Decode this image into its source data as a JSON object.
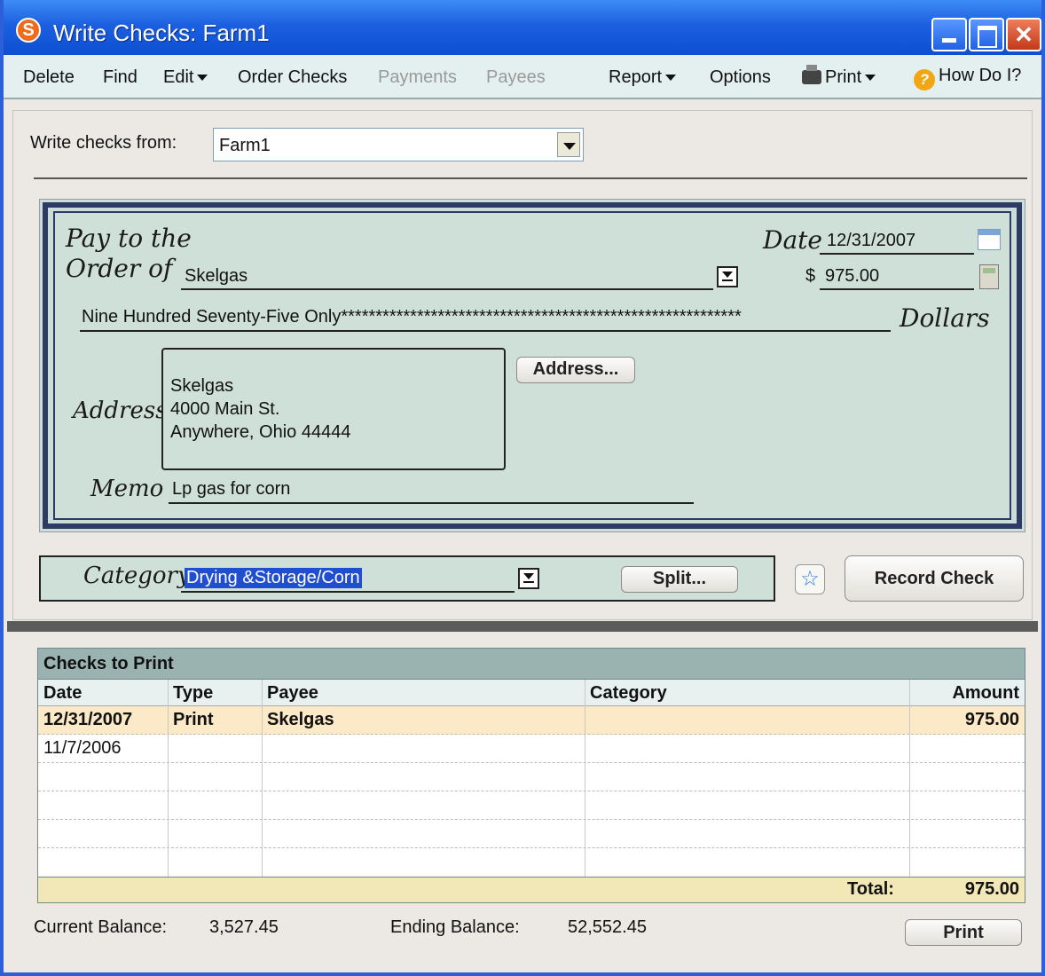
{
  "window": {
    "title": "Write Checks: Farm1",
    "close_glyph": "✕"
  },
  "menu": {
    "delete": "Delete",
    "find": "Find",
    "edit": "Edit",
    "order_checks": "Order Checks",
    "payments": "Payments",
    "payees": "Payees",
    "report": "Report",
    "options": "Options",
    "print": "Print",
    "how_do_i": "How Do I?"
  },
  "account": {
    "label": "Write checks from:",
    "value": "Farm1"
  },
  "check": {
    "pay_label_line1": "Pay to the",
    "pay_label_line2": "Order of",
    "payee": "Skelgas",
    "date_label": "Date",
    "date": "12/31/2007",
    "dollar_sign": "$",
    "amount": "975.00",
    "amount_words": "Nine Hundred Seventy-Five Only**********************************************************",
    "dollars_label": "Dollars",
    "address_label": "Address",
    "address_lines": [
      "Skelgas",
      "4000 Main St.",
      "Anywhere, Ohio 44444"
    ],
    "address_button": "Address...",
    "memo_label": "Memo",
    "memo": "Lp gas for corn"
  },
  "category": {
    "label": "Category",
    "value": "Drying &Storage/Corn",
    "split_button": "Split...",
    "record_button": "Record Check"
  },
  "checks_to_print": {
    "title": "Checks to Print",
    "columns": {
      "date": "Date",
      "type": "Type",
      "payee": "Payee",
      "category": "Category",
      "amount": "Amount"
    },
    "rows": [
      {
        "date": "12/31/2007",
        "type": "Print",
        "payee": "Skelgas",
        "category": "",
        "amount": "975.00"
      },
      {
        "date": "11/7/2006",
        "type": "",
        "payee": "",
        "category": "",
        "amount": ""
      }
    ],
    "total_label": "Total:",
    "total_value": "975.00"
  },
  "footer": {
    "current_balance_label": "Current Balance:",
    "current_balance": "3,527.45",
    "ending_balance_label": "Ending Balance:",
    "ending_balance": "52,552.45",
    "print_button": "Print"
  }
}
